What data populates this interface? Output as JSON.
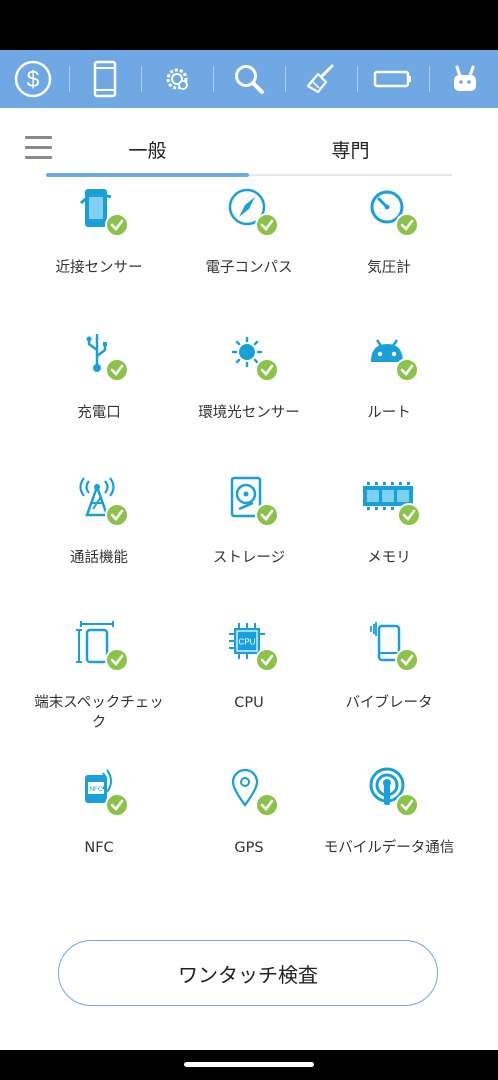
{
  "colors": {
    "accent": "#6fa8e3",
    "icon": "#1aa0d8",
    "check": "#8bc34a"
  },
  "toolbar": {
    "items": [
      {
        "icon": "dollar-icon"
      },
      {
        "icon": "phone-icon"
      },
      {
        "icon": "gear-icon"
      },
      {
        "icon": "search-icon"
      },
      {
        "icon": "broom-icon"
      },
      {
        "icon": "battery-icon"
      },
      {
        "icon": "rabbit-icon"
      }
    ]
  },
  "tabs": {
    "general": "一般",
    "expert": "専門",
    "selected": "一般"
  },
  "grid": {
    "items": [
      {
        "label": "近接センサー",
        "icon": "proximity-sensor-icon",
        "status": "ok"
      },
      {
        "label": "電子コンパス",
        "icon": "compass-icon",
        "status": "ok"
      },
      {
        "label": "気圧計",
        "icon": "barometer-icon",
        "status": "ok"
      },
      {
        "label": "充電口",
        "icon": "usb-icon",
        "status": "ok"
      },
      {
        "label": "環境光センサー",
        "icon": "ambient-light-icon",
        "status": "ok"
      },
      {
        "label": "ルート",
        "icon": "android-root-icon",
        "status": "ok"
      },
      {
        "label": "通話機能",
        "icon": "antenna-icon",
        "status": "ok"
      },
      {
        "label": "ストレージ",
        "icon": "hard-disk-icon",
        "status": "ok"
      },
      {
        "label": "メモリ",
        "icon": "memory-icon",
        "status": "ok"
      },
      {
        "label": "端末スペックチェック",
        "icon": "device-spec-icon",
        "status": "ok"
      },
      {
        "label": "CPU",
        "icon": "cpu-icon",
        "status": "ok"
      },
      {
        "label": "バイブレータ",
        "icon": "vibration-icon",
        "status": "ok"
      },
      {
        "label": "NFC",
        "icon": "nfc-icon",
        "status": "ok"
      },
      {
        "label": "GPS",
        "icon": "gps-icon",
        "status": "ok"
      },
      {
        "label": "モバイルデータ通信",
        "icon": "mobile-data-icon",
        "status": "ok"
      }
    ]
  },
  "action": {
    "label": "ワンタッチ検査"
  }
}
